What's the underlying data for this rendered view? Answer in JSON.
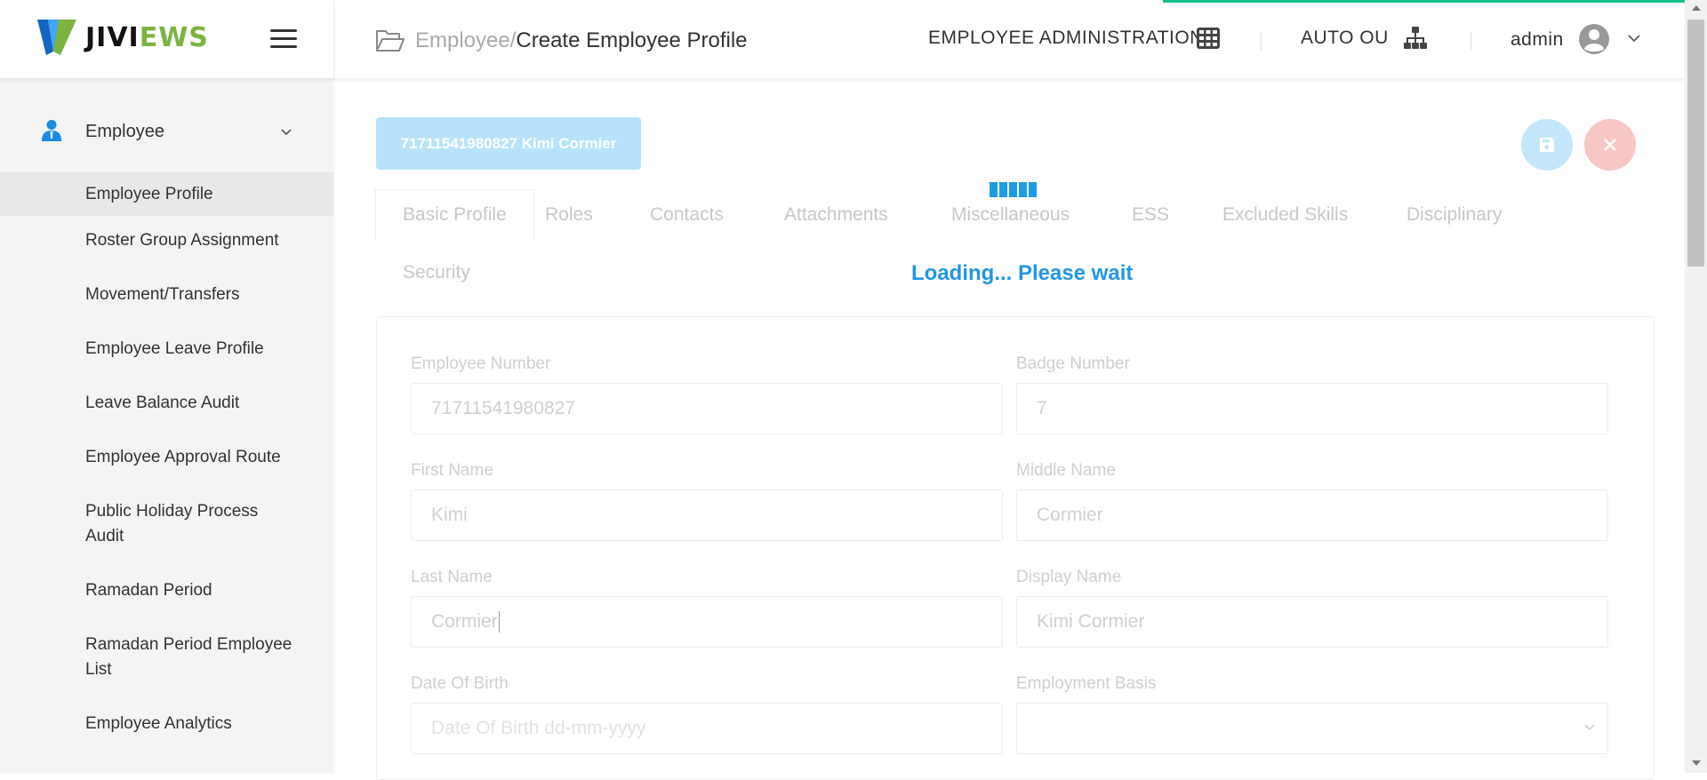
{
  "brand": {
    "name_part1": "JIVI",
    "name_part2": "EWS"
  },
  "sidebar": {
    "section_label": "Employee",
    "items": [
      {
        "label": "Employee Profile",
        "active": true
      },
      {
        "label": "Roster Group Assignment"
      },
      {
        "label": "Movement/Transfers"
      },
      {
        "label": "Employee Leave Profile"
      },
      {
        "label": "Leave Balance Audit"
      },
      {
        "label": "Employee Approval Route"
      },
      {
        "label": "Public Holiday Process Audit"
      },
      {
        "label": "Ramadan Period"
      },
      {
        "label": "Ramadan Period Employee List"
      },
      {
        "label": "Employee Analytics"
      }
    ]
  },
  "header": {
    "breadcrumb_parent": "Employee/",
    "breadcrumb_current": "Create Employee Profile",
    "module": "EMPLOYEE ADMINISTRATION",
    "org_unit": "AUTO OU",
    "user": "admin"
  },
  "employee_chip": "71711541980827 Kimi Cormier",
  "tabs": [
    "Basic Profile",
    "Roles",
    "Contacts",
    "Attachments",
    "Miscellaneous",
    "ESS",
    "Excluded Skills",
    "Disciplinary",
    "Security"
  ],
  "form": {
    "employee_number": {
      "label": "Employee Number",
      "value": "71711541980827"
    },
    "badge_number": {
      "label": "Badge Number",
      "value": "7"
    },
    "first_name": {
      "label": "First Name",
      "value": "Kimi"
    },
    "middle_name": {
      "label": "Middle Name",
      "value": "Cormier"
    },
    "last_name": {
      "label": "Last Name",
      "value": "Cormier"
    },
    "display_name": {
      "label": "Display Name",
      "value": "Kimi Cormier"
    },
    "date_of_birth": {
      "label": "Date Of Birth",
      "placeholder": "Date Of Birth dd-mm-yyyy"
    },
    "employment_basis": {
      "label": "Employment Basis",
      "value": ""
    }
  },
  "loading": {
    "message": "Loading... Please wait"
  },
  "colors": {
    "accent": "#2196e6",
    "progress": "#16c08a",
    "save_button": "#c4e6fb",
    "close_button": "#f6c7c5",
    "brand_green": "#7cb342"
  }
}
